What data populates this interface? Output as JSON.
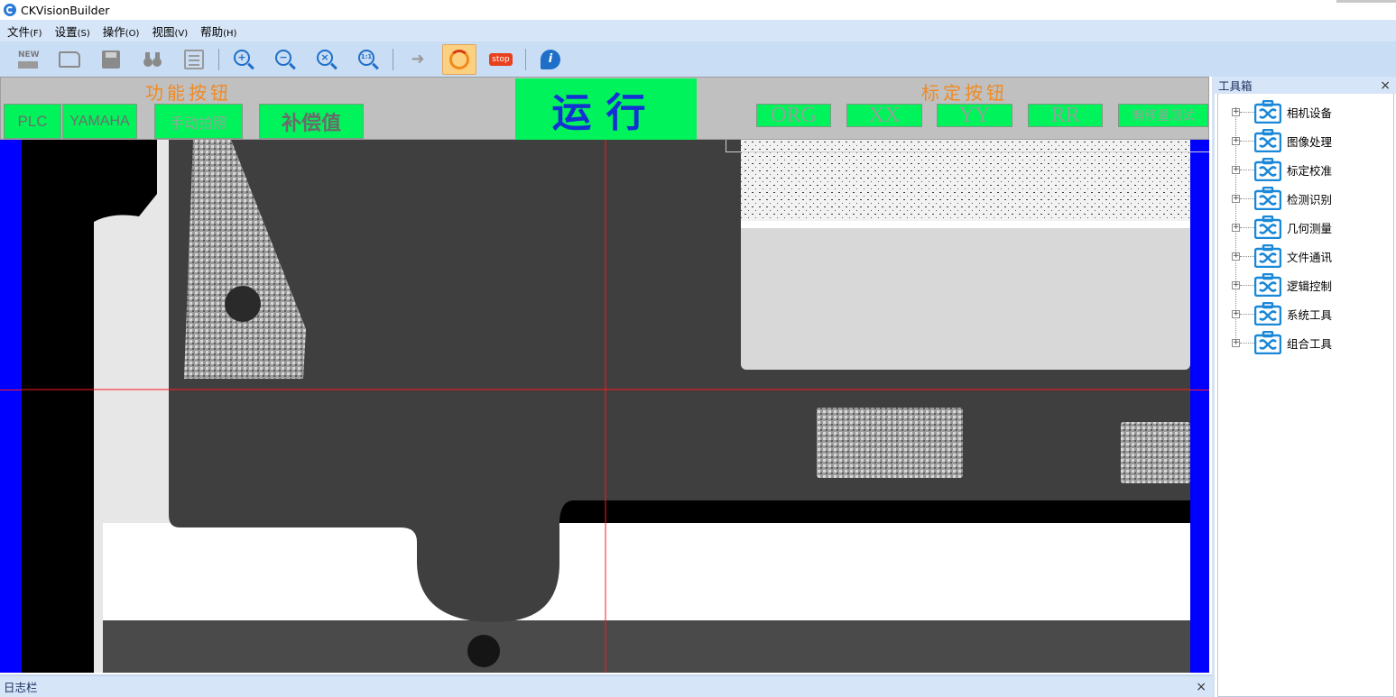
{
  "window": {
    "title": "CKVisionBuilder"
  },
  "menu": [
    {
      "label": "文件",
      "hotkey": "(F)"
    },
    {
      "label": "设置",
      "hotkey": "(S)"
    },
    {
      "label": "操作",
      "hotkey": "(O)"
    },
    {
      "label": "视图",
      "hotkey": "(V)"
    },
    {
      "label": "帮助",
      "hotkey": "(H)"
    }
  ],
  "toolbar": {
    "new_label": "NEW",
    "zoom_reset_label": "1:1",
    "stop_label": "stop",
    "info_label": "i",
    "icons": [
      "new-icon",
      "open-folder-icon",
      "save-icon",
      "binoculars-icon",
      "fit-window-icon",
      "zoom-in-icon",
      "zoom-out-icon",
      "zoom-fit-icon",
      "zoom-actual-icon",
      "step-arrow-icon",
      "continuous-run-icon",
      "stop-icon",
      "info-icon"
    ]
  },
  "function_panel": {
    "group_function": "功能按钮",
    "group_calibration": "标定按钮",
    "buttons": {
      "plc": "PLC",
      "yamaha": "YAMAHA",
      "manual_photo": "手动拍照",
      "compensation": "补偿值",
      "run": "运行",
      "org": "ORG",
      "xx": "XX",
      "yy": "YY",
      "rr": "RR",
      "offset_test": "偏移量测试"
    },
    "colors": {
      "button_bg": "#00f35a",
      "group_title": "#f08a22",
      "run_text": "#1431d4"
    }
  },
  "toolbox": {
    "title": "工具箱",
    "close": "×",
    "items": [
      {
        "label": "相机设备"
      },
      {
        "label": "图像处理"
      },
      {
        "label": "标定校准"
      },
      {
        "label": "检测识别"
      },
      {
        "label": "几何测量"
      },
      {
        "label": "文件通讯"
      },
      {
        "label": "逻辑控制"
      },
      {
        "label": "系统工具"
      },
      {
        "label": "组合工具"
      }
    ]
  },
  "log_panel": {
    "title": "日志栏",
    "close": "×"
  }
}
